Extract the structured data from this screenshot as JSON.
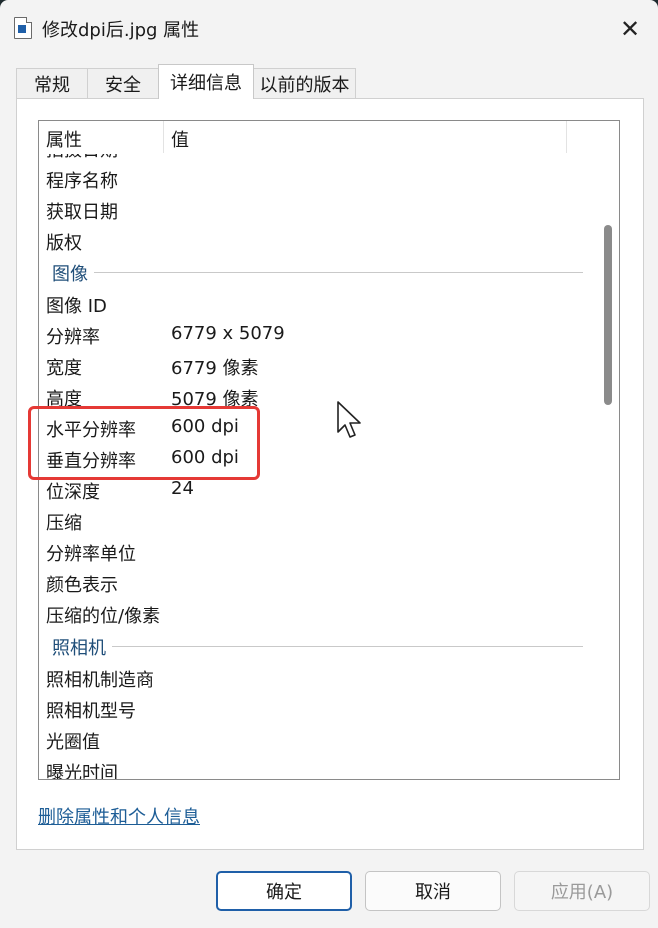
{
  "window": {
    "title": "修改dpi后.jpg 属性",
    "close_label": "✕"
  },
  "tabs": [
    {
      "label": "常规"
    },
    {
      "label": "安全"
    },
    {
      "label": "详细信息"
    },
    {
      "label": "以前的版本"
    }
  ],
  "list": {
    "header_property": "属性",
    "header_value": "值",
    "partial_top_row": "拍摄日期",
    "rows_top": [
      {
        "name": "程序名称",
        "value": ""
      },
      {
        "name": "获取日期",
        "value": ""
      },
      {
        "name": "版权",
        "value": ""
      }
    ],
    "group_image": "图像",
    "rows_image": [
      {
        "name": "图像 ID",
        "value": ""
      },
      {
        "name": "分辨率",
        "value": "6779 x 5079"
      },
      {
        "name": "宽度",
        "value": "6779 像素"
      },
      {
        "name": "高度",
        "value": "5079 像素"
      },
      {
        "name": "水平分辨率",
        "value": "600 dpi"
      },
      {
        "name": "垂直分辨率",
        "value": "600 dpi"
      },
      {
        "name": "位深度",
        "value": "24"
      },
      {
        "name": "压缩",
        "value": ""
      },
      {
        "name": "分辨率单位",
        "value": ""
      },
      {
        "name": "颜色表示",
        "value": ""
      },
      {
        "name": "压缩的位/像素",
        "value": ""
      }
    ],
    "group_camera": "照相机",
    "rows_camera": [
      {
        "name": "照相机制造商",
        "value": ""
      },
      {
        "name": "照相机型号",
        "value": ""
      },
      {
        "name": "光圈值",
        "value": ""
      },
      {
        "name": "曝光时间",
        "value": ""
      }
    ]
  },
  "remove_link": "删除属性和个人信息",
  "buttons": {
    "ok": "确定",
    "cancel": "取消",
    "apply": "应用(A)"
  },
  "colors": {
    "highlight": "#e53935",
    "group_text": "#1f4e79",
    "link": "#1d5d96",
    "primary_border": "#1f5fa8"
  }
}
